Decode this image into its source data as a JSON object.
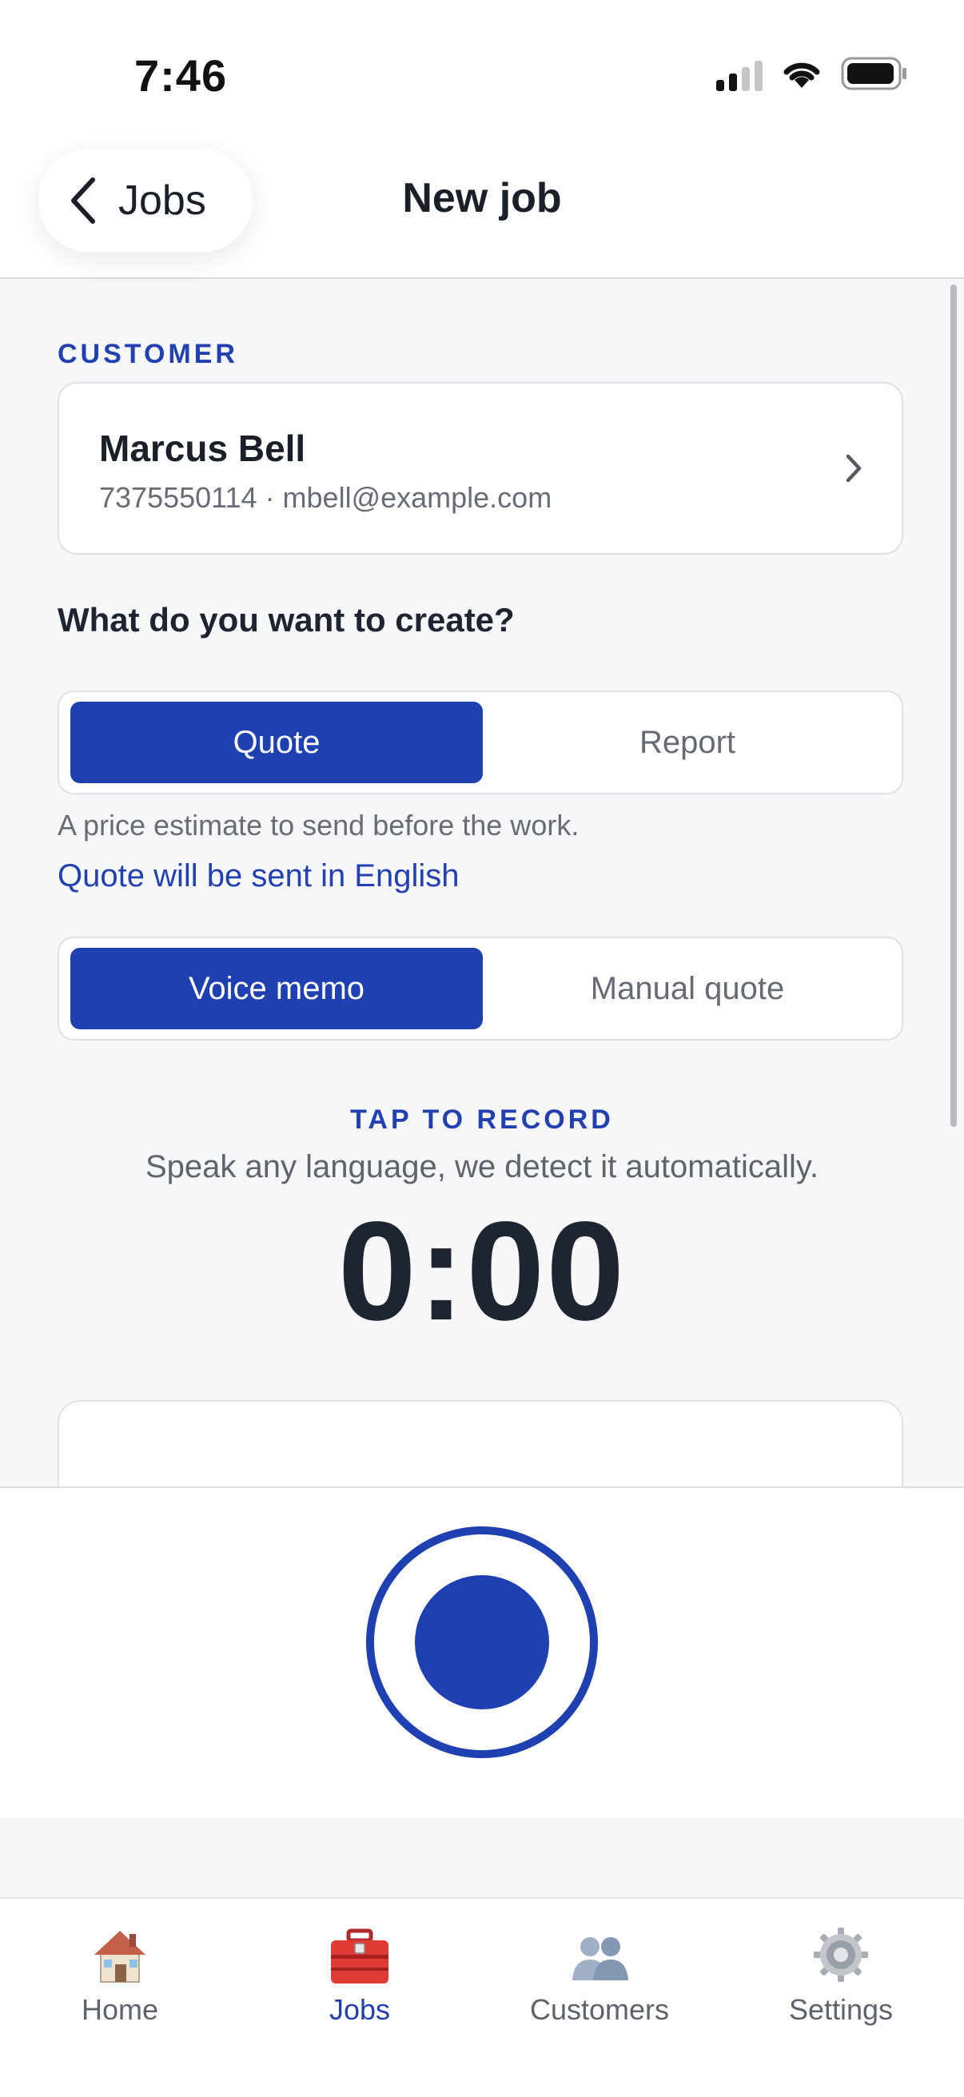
{
  "status_bar": {
    "time": "7:46"
  },
  "nav": {
    "back_label": "Jobs",
    "title": "New job"
  },
  "customer": {
    "section_label": "CUSTOMER",
    "name": "Marcus Bell",
    "contact": "7375550114 · mbell@example.com"
  },
  "create": {
    "question": "What do you want to create?",
    "options": [
      "Quote",
      "Report"
    ],
    "selected": "Quote",
    "hint": "A price estimate to send before the work.",
    "language_link": "Quote will be sent in English"
  },
  "input_mode": {
    "options": [
      "Voice memo",
      "Manual quote"
    ],
    "selected": "Voice memo"
  },
  "recorder": {
    "label": "TAP TO RECORD",
    "subtitle": "Speak any language, we detect it automatically.",
    "timer": "0:00"
  },
  "tabbar": {
    "items": [
      {
        "label": "Home",
        "icon": "house-icon"
      },
      {
        "label": "Jobs",
        "icon": "toolbox-icon"
      },
      {
        "label": "Customers",
        "icon": "people-icon"
      },
      {
        "label": "Settings",
        "icon": "gear-icon"
      }
    ],
    "active": "Jobs"
  },
  "colors": {
    "accent": "#1f40b0",
    "background": "#f6f7f8"
  }
}
